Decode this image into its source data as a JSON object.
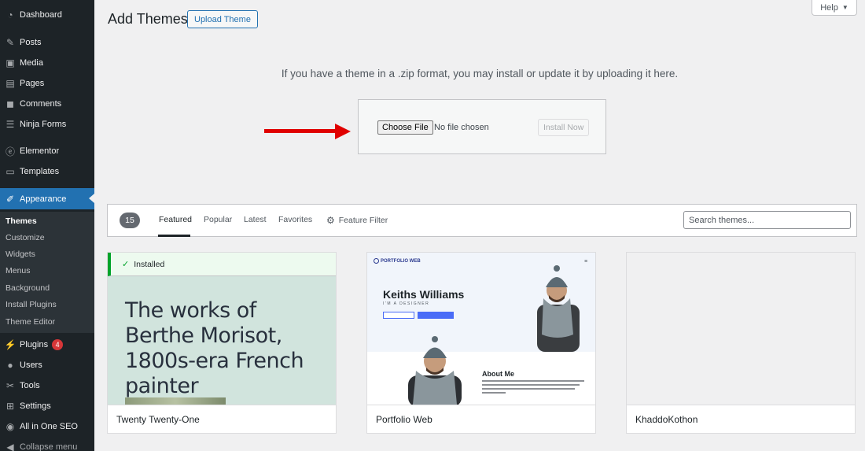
{
  "sidebar": {
    "items": [
      {
        "label": "Dashboard",
        "icon": "dashboard-icon"
      },
      {
        "label": "Posts",
        "icon": "pin-icon"
      },
      {
        "label": "Media",
        "icon": "media-icon"
      },
      {
        "label": "Pages",
        "icon": "pages-icon"
      },
      {
        "label": "Comments",
        "icon": "comment-icon"
      },
      {
        "label": "Ninja Forms",
        "icon": "forms-icon"
      },
      {
        "label": "Elementor",
        "icon": "elementor-icon"
      },
      {
        "label": "Templates",
        "icon": "folder-icon"
      },
      {
        "label": "Appearance",
        "icon": "brush-icon"
      },
      {
        "label": "Plugins",
        "icon": "plugin-icon",
        "badge": "4"
      },
      {
        "label": "Users",
        "icon": "users-icon"
      },
      {
        "label": "Tools",
        "icon": "wrench-icon"
      },
      {
        "label": "Settings",
        "icon": "settings-icon"
      },
      {
        "label": "All in One SEO",
        "icon": "seo-icon"
      },
      {
        "label": "Collapse menu",
        "icon": "collapse-icon"
      }
    ],
    "submenu": [
      "Themes",
      "Customize",
      "Widgets",
      "Menus",
      "Background",
      "Install Plugins",
      "Theme Editor"
    ]
  },
  "header": {
    "title": "Add Themes",
    "upload_label": "Upload Theme",
    "help_label": "Help"
  },
  "upload": {
    "description": "If you have a theme in a .zip format, you may install or update it by uploading it here.",
    "choose_label": "Choose File",
    "no_file": "No file chosen",
    "install_label": "Install Now"
  },
  "filter": {
    "count": "15",
    "tabs": [
      "Featured",
      "Popular",
      "Latest",
      "Favorites"
    ],
    "feature_filter": "Feature Filter",
    "search_placeholder": "Search themes..."
  },
  "themes": [
    {
      "name": "Twenty Twenty-One",
      "installed_label": "Installed",
      "preview_heading": "The works of Berthe Morisot, 1800s-era French painter"
    },
    {
      "name": "Portfolio Web",
      "preview_logo": "PORTFOLIO WEB",
      "preview_name": "Keiths Williams",
      "preview_role": "I'M A DESIGNER",
      "preview_about": "About Me"
    },
    {
      "name": "KhaddoKothon"
    }
  ],
  "colors": {
    "sidebar_bg": "#1d2327",
    "accent": "#2271b1",
    "badge": "#d63638",
    "arrow": "#e00000",
    "installed": "#00a32a"
  }
}
